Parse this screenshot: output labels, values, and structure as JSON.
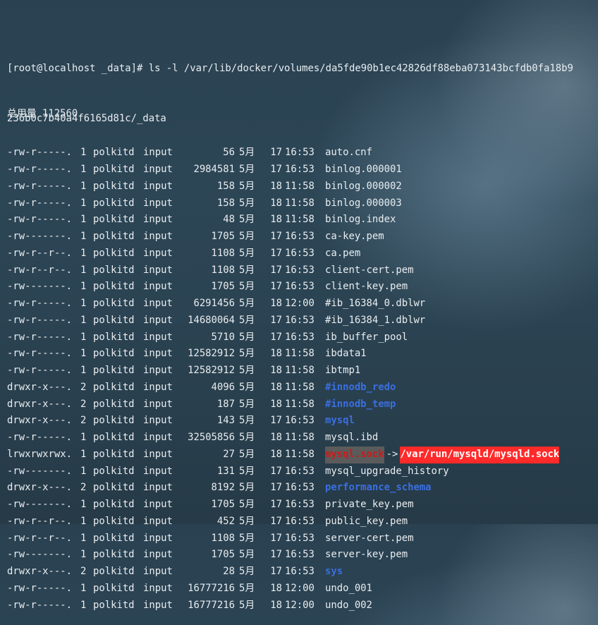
{
  "prompt": {
    "line1": "[root@localhost _data]# ls -l /var/lib/docker/volumes/da5fde90b1ec42826df88eba073143bcfdb0fa18b9",
    "line2": "236b0c7b40a4f6165d81c/_data"
  },
  "total_line": "总用量 112560",
  "files": [
    {
      "perm": "-rw-r-----.",
      "links": "1",
      "owner": "polkitd",
      "group": "input",
      "size": "56",
      "month": "5月",
      "day": "17",
      "time": "16:53",
      "name": "auto.cnf",
      "kind": "file"
    },
    {
      "perm": "-rw-r-----.",
      "links": "1",
      "owner": "polkitd",
      "group": "input",
      "size": "2984581",
      "month": "5月",
      "day": "17",
      "time": "16:53",
      "name": "binlog.000001",
      "kind": "file"
    },
    {
      "perm": "-rw-r-----.",
      "links": "1",
      "owner": "polkitd",
      "group": "input",
      "size": "158",
      "month": "5月",
      "day": "18",
      "time": "11:58",
      "name": "binlog.000002",
      "kind": "file"
    },
    {
      "perm": "-rw-r-----.",
      "links": "1",
      "owner": "polkitd",
      "group": "input",
      "size": "158",
      "month": "5月",
      "day": "18",
      "time": "11:58",
      "name": "binlog.000003",
      "kind": "file"
    },
    {
      "perm": "-rw-r-----.",
      "links": "1",
      "owner": "polkitd",
      "group": "input",
      "size": "48",
      "month": "5月",
      "day": "18",
      "time": "11:58",
      "name": "binlog.index",
      "kind": "file"
    },
    {
      "perm": "-rw-------.",
      "links": "1",
      "owner": "polkitd",
      "group": "input",
      "size": "1705",
      "month": "5月",
      "day": "17",
      "time": "16:53",
      "name": "ca-key.pem",
      "kind": "file"
    },
    {
      "perm": "-rw-r--r--.",
      "links": "1",
      "owner": "polkitd",
      "group": "input",
      "size": "1108",
      "month": "5月",
      "day": "17",
      "time": "16:53",
      "name": "ca.pem",
      "kind": "file"
    },
    {
      "perm": "-rw-r--r--.",
      "links": "1",
      "owner": "polkitd",
      "group": "input",
      "size": "1108",
      "month": "5月",
      "day": "17",
      "time": "16:53",
      "name": "client-cert.pem",
      "kind": "file"
    },
    {
      "perm": "-rw-------.",
      "links": "1",
      "owner": "polkitd",
      "group": "input",
      "size": "1705",
      "month": "5月",
      "day": "17",
      "time": "16:53",
      "name": "client-key.pem",
      "kind": "file"
    },
    {
      "perm": "-rw-r-----.",
      "links": "1",
      "owner": "polkitd",
      "group": "input",
      "size": "6291456",
      "month": "5月",
      "day": "18",
      "time": "12:00",
      "name": "#ib_16384_0.dblwr",
      "kind": "file"
    },
    {
      "perm": "-rw-r-----.",
      "links": "1",
      "owner": "polkitd",
      "group": "input",
      "size": "14680064",
      "month": "5月",
      "day": "17",
      "time": "16:53",
      "name": "#ib_16384_1.dblwr",
      "kind": "file"
    },
    {
      "perm": "-rw-r-----.",
      "links": "1",
      "owner": "polkitd",
      "group": "input",
      "size": "5710",
      "month": "5月",
      "day": "17",
      "time": "16:53",
      "name": "ib_buffer_pool",
      "kind": "file"
    },
    {
      "perm": "-rw-r-----.",
      "links": "1",
      "owner": "polkitd",
      "group": "input",
      "size": "12582912",
      "month": "5月",
      "day": "18",
      "time": "11:58",
      "name": "ibdata1",
      "kind": "file"
    },
    {
      "perm": "-rw-r-----.",
      "links": "1",
      "owner": "polkitd",
      "group": "input",
      "size": "12582912",
      "month": "5月",
      "day": "18",
      "time": "11:58",
      "name": "ibtmp1",
      "kind": "file"
    },
    {
      "perm": "drwxr-x---.",
      "links": "2",
      "owner": "polkitd",
      "group": "input",
      "size": "4096",
      "month": "5月",
      "day": "18",
      "time": "11:58",
      "name": "#innodb_redo",
      "kind": "dir"
    },
    {
      "perm": "drwxr-x---.",
      "links": "2",
      "owner": "polkitd",
      "group": "input",
      "size": "187",
      "month": "5月",
      "day": "18",
      "time": "11:58",
      "name": "#innodb_temp",
      "kind": "dir"
    },
    {
      "perm": "drwxr-x---.",
      "links": "2",
      "owner": "polkitd",
      "group": "input",
      "size": "143",
      "month": "5月",
      "day": "17",
      "time": "16:53",
      "name": "mysql",
      "kind": "dir"
    },
    {
      "perm": "-rw-r-----.",
      "links": "1",
      "owner": "polkitd",
      "group": "input",
      "size": "32505856",
      "month": "5月",
      "day": "18",
      "time": "11:58",
      "name": "mysql.ibd",
      "kind": "file"
    },
    {
      "perm": "lrwxrwxrwx.",
      "links": "1",
      "owner": "polkitd",
      "group": "input",
      "size": "27",
      "month": "5月",
      "day": "18",
      "time": "11:58",
      "name": "mysql.sock",
      "kind": "link",
      "arrow": "->",
      "target": "/var/run/mysqld/mysqld.sock"
    },
    {
      "perm": "-rw-------.",
      "links": "1",
      "owner": "polkitd",
      "group": "input",
      "size": "131",
      "month": "5月",
      "day": "17",
      "time": "16:53",
      "name": "mysql_upgrade_history",
      "kind": "file"
    },
    {
      "perm": "drwxr-x---.",
      "links": "2",
      "owner": "polkitd",
      "group": "input",
      "size": "8192",
      "month": "5月",
      "day": "17",
      "time": "16:53",
      "name": "performance_schema",
      "kind": "dir"
    },
    {
      "perm": "-rw-------.",
      "links": "1",
      "owner": "polkitd",
      "group": "input",
      "size": "1705",
      "month": "5月",
      "day": "17",
      "time": "16:53",
      "name": "private_key.pem",
      "kind": "file"
    },
    {
      "perm": "-rw-r--r--.",
      "links": "1",
      "owner": "polkitd",
      "group": "input",
      "size": "452",
      "month": "5月",
      "day": "17",
      "time": "16:53",
      "name": "public_key.pem",
      "kind": "file"
    },
    {
      "perm": "-rw-r--r--.",
      "links": "1",
      "owner": "polkitd",
      "group": "input",
      "size": "1108",
      "month": "5月",
      "day": "17",
      "time": "16:53",
      "name": "server-cert.pem",
      "kind": "file"
    },
    {
      "perm": "-rw-------.",
      "links": "1",
      "owner": "polkitd",
      "group": "input",
      "size": "1705",
      "month": "5月",
      "day": "17",
      "time": "16:53",
      "name": "server-key.pem",
      "kind": "file"
    },
    {
      "perm": "drwxr-x---.",
      "links": "2",
      "owner": "polkitd",
      "group": "input",
      "size": "28",
      "month": "5月",
      "day": "17",
      "time": "16:53",
      "name": "sys",
      "kind": "dir"
    },
    {
      "perm": "-rw-r-----.",
      "links": "1",
      "owner": "polkitd",
      "group": "input",
      "size": "16777216",
      "month": "5月",
      "day": "18",
      "time": "12:00",
      "name": "undo_001",
      "kind": "file"
    },
    {
      "perm": "-rw-r-----.",
      "links": "1",
      "owner": "polkitd",
      "group": "input",
      "size": "16777216",
      "month": "5月",
      "day": "18",
      "time": "12:00",
      "name": "undo_002",
      "kind": "file"
    }
  ],
  "colors": {
    "directory": "#3a6fe0",
    "socket_text": "#cc1a1a",
    "socket_bg": "#5b5b5b",
    "link_target_bg": "#ff2a2a"
  }
}
